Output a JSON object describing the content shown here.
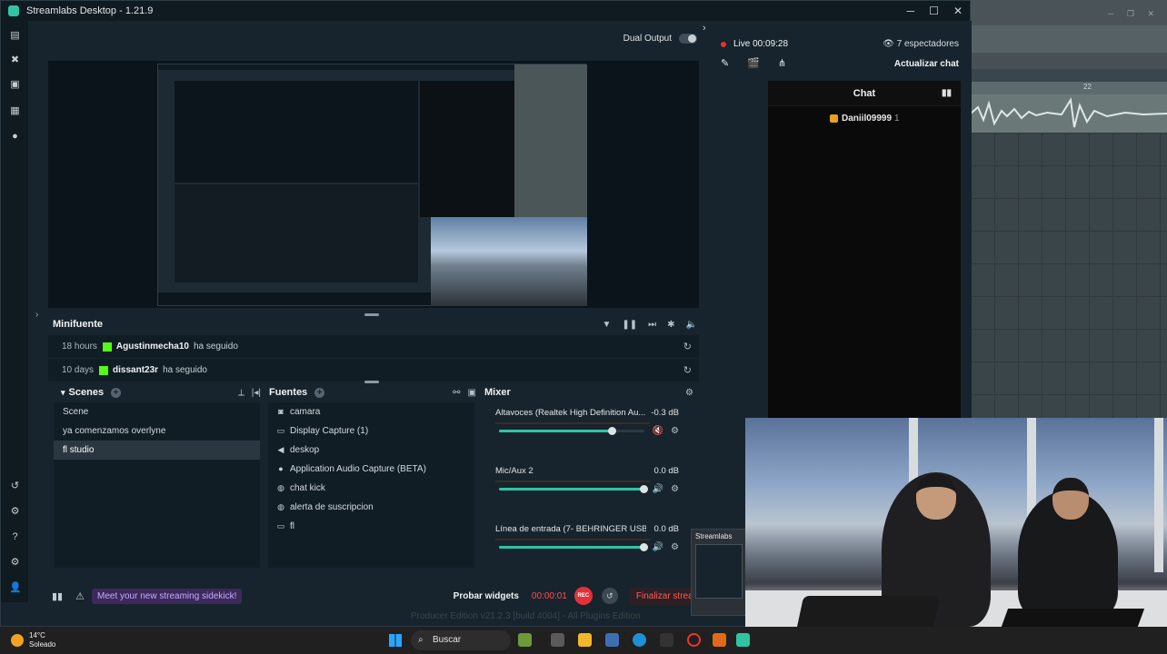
{
  "window": {
    "title": "Streamlabs Desktop - 1.21.9"
  },
  "studio": {
    "dual_output_label": "Dual Output",
    "minifuente": {
      "title": "Minifuente",
      "events": [
        {
          "ago": "18 hours",
          "user": "Agustinmecha10",
          "action": "ha seguido"
        },
        {
          "ago": "10 days",
          "user": "dissant23r",
          "action": "ha seguido"
        }
      ]
    },
    "scenes": {
      "title": "Scenes",
      "items": [
        "Scene",
        "ya comenzamos overlyne",
        "fl studio"
      ],
      "active_index": 2
    },
    "sources": {
      "title": "Fuentes",
      "items": [
        {
          "label": "camara",
          "icon": "camera-icon"
        },
        {
          "label": "Display Capture (1)",
          "icon": "monitor-icon"
        },
        {
          "label": "deskop",
          "icon": "speaker-icon"
        },
        {
          "label": "Application Audio Capture (BETA)",
          "icon": "user-audio-icon"
        },
        {
          "label": "chat kick",
          "icon": "globe-icon"
        },
        {
          "label": "alerta de suscripcion",
          "icon": "globe-icon"
        },
        {
          "label": "fl",
          "icon": "monitor-icon"
        }
      ]
    },
    "mixer": {
      "title": "Mixer",
      "channels": [
        {
          "name": "Altavoces (Realtek High Definition Au...",
          "db": "-0.3 dB",
          "level": 0.78,
          "muted": true
        },
        {
          "name": "Mic/Aux 2",
          "db": "0.0 dB",
          "level": 1.0,
          "muted": false
        },
        {
          "name": "Línea de entrada (7- BEHRINGER USB ...",
          "db": "0.0 dB",
          "level": 1.0,
          "muted": false
        }
      ]
    }
  },
  "footer": {
    "promo": "Meet your new streaming sidekick!",
    "test_widgets": "Probar widgets",
    "rec_timer": "00:00:01",
    "rec_label": "REC",
    "end_stream": "Finalizar stream"
  },
  "dock": {
    "live_status": "Live 00:09:28",
    "viewers": "7 espectadores",
    "refresh_chat": "Actualizar chat",
    "chat": {
      "title": "Chat",
      "messages": [
        {
          "user": "Daniil09999",
          "count": "1"
        }
      ]
    }
  },
  "taskbar_preview": {
    "label": "Streamlabs"
  },
  "taskbar": {
    "weather_temp": "14°C",
    "weather_desc": "Soleado",
    "search_label": "Buscar"
  },
  "background_daw": {
    "ruler_mark": "22",
    "footer_text": "Producer Edition v21.2.3 [build 4004] - All Plugins Edition"
  },
  "colors": {
    "accent": "#31c3a2",
    "live_red": "#e3313a",
    "kick_green": "#53fc18",
    "promo_purple": "#c9a9ff"
  }
}
